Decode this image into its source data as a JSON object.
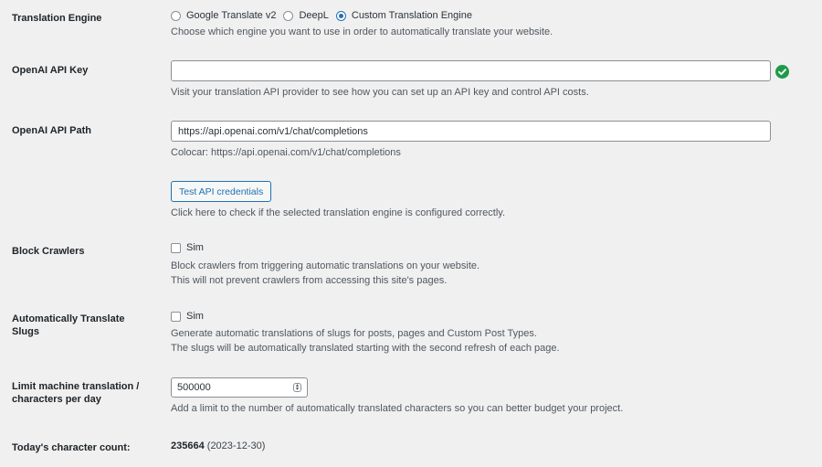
{
  "engine": {
    "label": "Translation Engine",
    "options": [
      "Google Translate v2",
      "DeepL",
      "Custom Translation Engine"
    ],
    "selected": "Custom Translation Engine",
    "description": "Choose which engine you want to use in order to automatically translate your website."
  },
  "api_key": {
    "label": "OpenAI API Key",
    "value": "",
    "description": "Visit your translation API provider to see how you can set up an API key and control API costs.",
    "status_icon": "check-circle-icon",
    "status_color": "#1e9a49"
  },
  "api_path": {
    "label": "OpenAI API Path",
    "value": "https://api.openai.com/v1/chat/completions",
    "description": "Colocar: https://api.openai.com/v1/chat/completions"
  },
  "test": {
    "button_label": "Test API credentials",
    "description": "Click here to check if the selected translation engine is configured correctly."
  },
  "block_crawlers": {
    "label": "Block Crawlers",
    "checkbox_label": "Sim",
    "checked": false,
    "description_1": "Block crawlers from triggering automatic translations on your website.",
    "description_2": "This will not prevent crawlers from accessing this site's pages."
  },
  "slugs": {
    "label_1": "Automatically Translate",
    "label_2": "Slugs",
    "checkbox_label": "Sim",
    "checked": false,
    "description_1": "Generate automatic translations of slugs for posts, pages and Custom Post Types.",
    "description_2": "The slugs will be automatically translated starting with the second refresh of each page."
  },
  "limit": {
    "label_1": "Limit machine translation /",
    "label_2": "characters per day",
    "value": "500000",
    "description": "Add a limit to the number of automatically translated characters so you can better budget your project."
  },
  "count": {
    "label": "Today's character count:",
    "value": "235664",
    "date": "(2023-12-30)"
  },
  "colors": {
    "accent": "#2271b1",
    "background": "#f0f0f1",
    "success": "#1e9a49"
  }
}
